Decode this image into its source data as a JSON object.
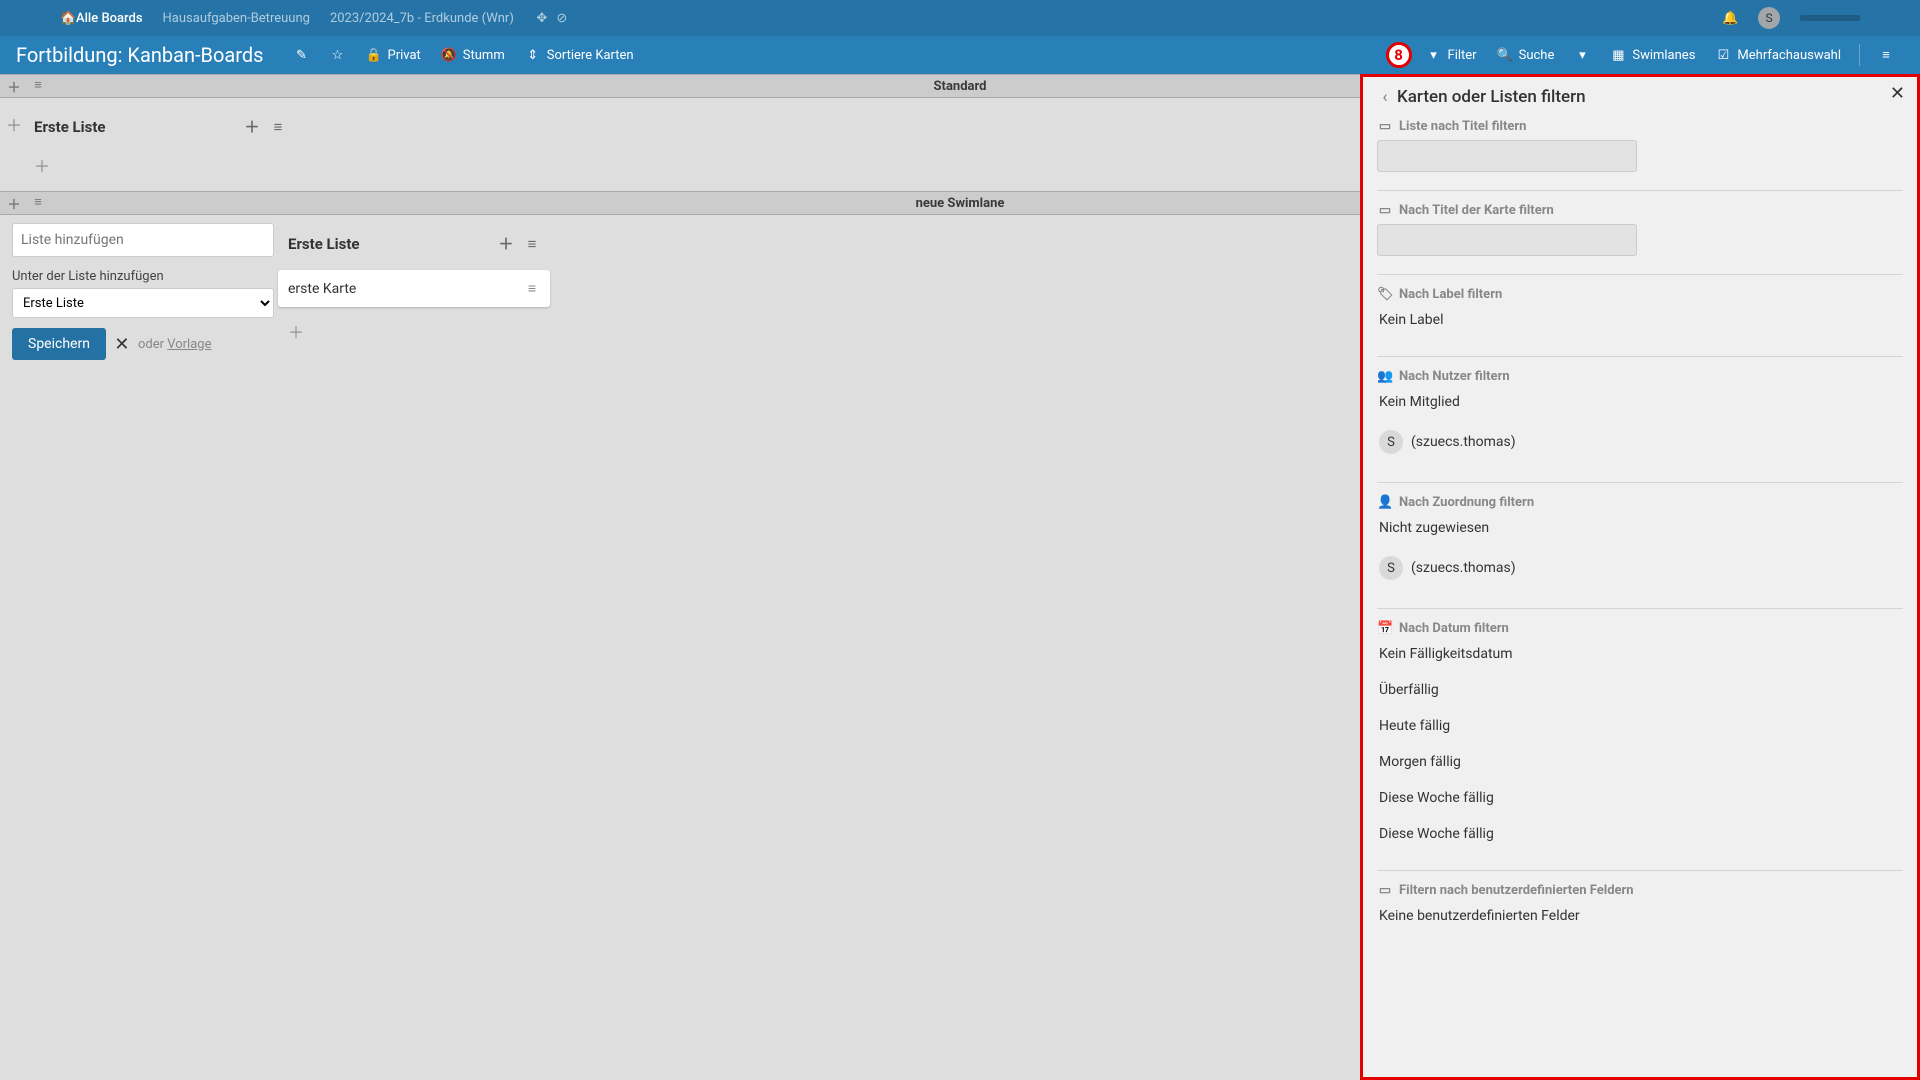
{
  "topnav": {
    "all_boards": "Alle Boards",
    "crumbs": [
      "Hausaufgaben-Betreuung",
      "2023/2024_7b - Erdkunde (Wnr)"
    ],
    "user_initial": "S"
  },
  "boardbar": {
    "title": "Fortbildung: Kanban-Boards",
    "privat": "Privat",
    "stumm": "Stumm",
    "sort": "Sortiere Karten",
    "filter": "Filter",
    "search": "Suche",
    "swimlanes": "Swimlanes",
    "multi": "Mehrfachauswahl",
    "callout": "8"
  },
  "swimlanes": [
    {
      "title": "Standard"
    },
    {
      "title": "neue Swimlane"
    }
  ],
  "lists": {
    "sl0": {
      "name": "Erste Liste"
    },
    "sl1": {
      "name": "Erste Liste"
    }
  },
  "card1": {
    "title": "erste Karte"
  },
  "addlist": {
    "placeholder": "Liste hinzufügen",
    "under_label": "Unter der Liste hinzufügen",
    "under_value": "Erste Liste",
    "save": "Speichern",
    "or": "oder",
    "template": "Vorlage"
  },
  "filter": {
    "title": "Karten oder Listen filtern",
    "list_title": "Liste nach Titel filtern",
    "card_title": "Nach Titel der Karte filtern",
    "label_title": "Nach Label filtern",
    "no_label": "Kein Label",
    "user_title": "Nach Nutzer filtern",
    "no_member": "Kein Mitglied",
    "user1": "(szuecs.thomas)",
    "assign_title": "Nach Zuordnung filtern",
    "not_assigned": "Nicht zugewiesen",
    "date_title": "Nach Datum filtern",
    "no_due": "Kein Fälligkeitsdatum",
    "overdue": "Überfällig",
    "due_today": "Heute fällig",
    "due_tomorrow": "Morgen fällig",
    "due_week1": "Diese Woche fällig",
    "due_week2": "Diese Woche fällig",
    "custom_title": "Filtern nach benutzerdefinierten Feldern",
    "no_custom": "Keine benutzerdefinierten Felder",
    "user_initial": "S"
  }
}
